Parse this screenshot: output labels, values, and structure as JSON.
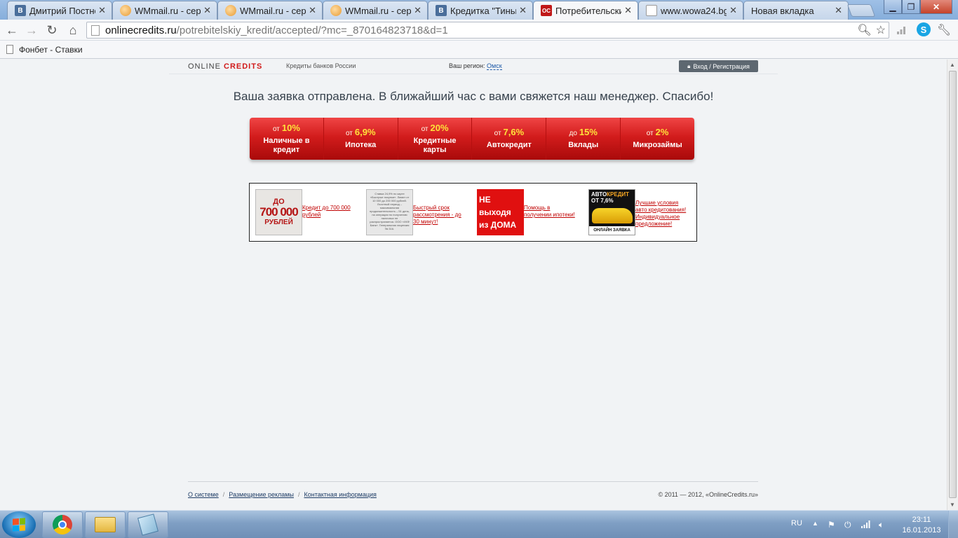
{
  "browser": {
    "tabs": [
      {
        "title": "Дмитрий Постно",
        "favicon": "vk-icon"
      },
      {
        "title": "WMmail.ru - сер",
        "favicon": "wmmail-icon"
      },
      {
        "title": "WMmail.ru - сер",
        "favicon": "wmmail-icon"
      },
      {
        "title": "WMmail.ru - сер",
        "favicon": "wmmail-icon"
      },
      {
        "title": "Кредитка \"Тиньк",
        "favicon": "vk-icon"
      },
      {
        "title": "Потребительски",
        "favicon": "onlinecredits-icon",
        "active": true
      },
      {
        "title": "www.wowa24.bg",
        "favicon": "page-icon"
      },
      {
        "title": "Новая вкладка",
        "favicon": "none"
      }
    ],
    "address": {
      "host": "onlinecredits.ru",
      "path": "/potrebitelskiy_kredit/accepted/?mc=_870164823718&d=1"
    },
    "bookmarks": [
      {
        "label": "Фонбет - Ставки"
      }
    ]
  },
  "site": {
    "logo_part1": "ONLINE ",
    "logo_part2": "CREDITS",
    "tagline": "Кредиты банков России",
    "region_label": "Ваш регион:",
    "region_value": "Омск",
    "login_label": "Вход  /  Регистрация",
    "message": "Ваша заявка отправлена. В ближайший час с вами свяжется наш менеджер. Спасибо!",
    "menu": [
      {
        "prefix": "от",
        "value": "10%",
        "label": "Наличные в кредит"
      },
      {
        "prefix": "от",
        "value": "6,9%",
        "label": "Ипотека"
      },
      {
        "prefix": "от",
        "value": "20%",
        "label": "Кредитные карты"
      },
      {
        "prefix": "от",
        "value": "7,6%",
        "label": "Автокредит"
      },
      {
        "prefix": "до",
        "value": "15%",
        "label": "Вклады"
      },
      {
        "prefix": "от",
        "value": "2%",
        "label": "Микрозаймы"
      }
    ],
    "banners": [
      {
        "img_lines": [
          "ДО",
          "700 000",
          "РУБЛЕЙ"
        ],
        "link": "Кредит до 700 000 рублей"
      },
      {
        "img_text": "Ставка 24,9% по карте «Быстрые покупки». Лимит от 10 000 до 200 000 рублей. Льготный период – максимальная продолжительность – 51 день, на операции по получению наличных не распространяется. ООО «ХКФ Банк». Генеральная лицензия № 316.",
        "link": "Быстрый срок рассмотрения - до 30 минут!"
      },
      {
        "img_lines": [
          "НЕ выходя",
          "из ДОМА"
        ],
        "link": "Помощь в получении ипотеки!"
      },
      {
        "img_title_a": "АВТО",
        "img_title_b": "КРЕДИТ",
        "img_rate": "ОТ 7,6%",
        "img_footer": "ОНЛАЙН ЗАЯВКА",
        "link": "Лучшие условия авто кредитования! Индивидуальное предложение!"
      }
    ],
    "footer": {
      "links": [
        "О системе",
        "Размещение рекламы",
        "Контактная информация"
      ],
      "copyright": "© 2011 — 2012, «OnlineCredits.ru»"
    }
  },
  "taskbar": {
    "apps": [
      {
        "icon": "chrome-icon"
      },
      {
        "icon": "folder-icon"
      },
      {
        "icon": "notepad-icon"
      }
    ],
    "language": "RU",
    "time": "23:11",
    "date": "16.01.2013"
  }
}
